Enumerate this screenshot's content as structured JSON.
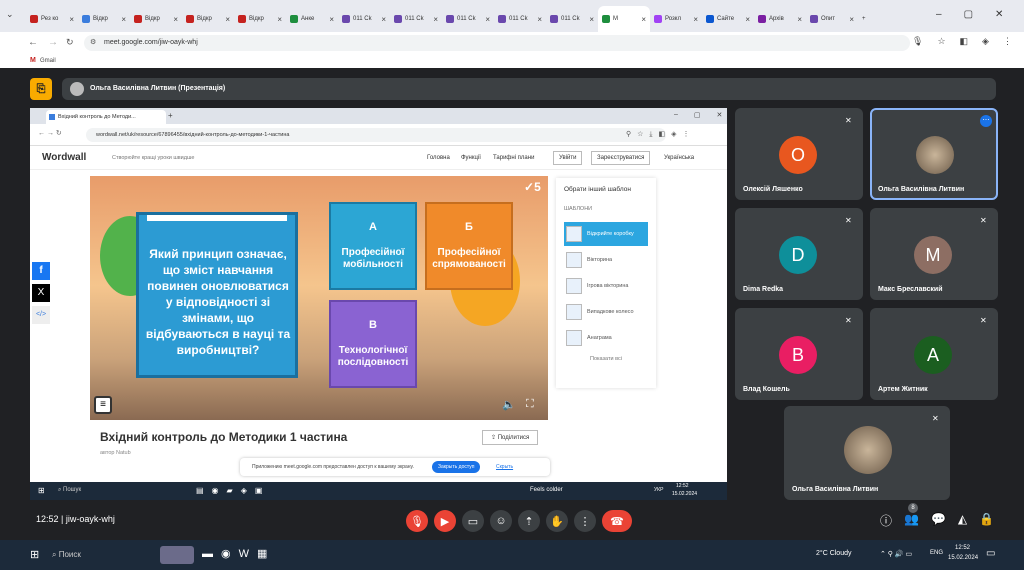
{
  "browser": {
    "tabs": [
      {
        "label": "Рез ко"
      },
      {
        "label": "Відкр"
      },
      {
        "label": "Відкр"
      },
      {
        "label": "Відкр"
      },
      {
        "label": "Відкр"
      },
      {
        "label": "Анке"
      },
      {
        "label": "011 Ck"
      },
      {
        "label": "011 Ck"
      },
      {
        "label": "011 Ck"
      },
      {
        "label": "011 Ck"
      },
      {
        "label": "011 Ck"
      },
      {
        "label": "М"
      },
      {
        "label": "Розкл"
      },
      {
        "label": "Сайте"
      },
      {
        "label": "Архів"
      },
      {
        "label": "Опит"
      }
    ],
    "url": "meet.google.com/jiw-oayk-whj",
    "bookmark": "Gmail"
  },
  "meet": {
    "presenter_label": "Ольга Василівна Литвин (Презентація)",
    "meeting_time": "12:52",
    "meeting_code": "jiw-oayk-whj",
    "people_count": "8",
    "participants": [
      {
        "name": "Олексій Ляшенко",
        "initial": "О",
        "color": "#e8571f"
      },
      {
        "name": "Ольга Василівна Литвин",
        "initial": "",
        "color": "#888"
      },
      {
        "name": "Dima Redka",
        "initial": "D",
        "color": "#0e8f9a"
      },
      {
        "name": "Макс Бреславский",
        "initial": "М",
        "color": "#8d6e63"
      },
      {
        "name": "Влад Кошель",
        "initial": "В",
        "color": "#e91e63"
      },
      {
        "name": "Артем Житник",
        "initial": "А",
        "color": "#1b5e20"
      }
    ],
    "self_name": "Ольга Василівна Литвин"
  },
  "shared": {
    "tab_title": "Вхідний контроль до Методи...",
    "url": "wordwall.net/uk/resource/67896455/вхідний-контроль-до-методики-1-частина",
    "logo": "Wordwall",
    "tagline": "Створюйте кращі уроки швидше",
    "nav": [
      "Головна",
      "Функції",
      "Тарифні плани"
    ],
    "login": "Увійти",
    "signup": "Зареєструватися",
    "lang": "Українська",
    "question": "Який принцип означає, що зміст навчання повинен оновлюватися у відповідності зі змінами, що відбуваються в науці та виробництві?",
    "score": "5",
    "answers": [
      {
        "letter": "А",
        "text": "Професійної мобільності",
        "color": "#2ca6d4"
      },
      {
        "letter": "Б",
        "text": "Професійної спрямованості",
        "color": "#f08a2a"
      },
      {
        "letter": "В",
        "text": "Технологічної послідовності",
        "color": "#8a63d2"
      }
    ],
    "sidebar_title": "Обрати інший шаблон",
    "sidebar_sub": "ШАБЛОНИ",
    "templates": [
      "Відкрийте коробку",
      "Вікторина",
      "Ігрова вікторина",
      "Випадкове колесо",
      "Анаграма"
    ],
    "show_all": "Показати всі",
    "activity_title": "Вхідний контроль до Методики 1 частина",
    "author_label": "автор",
    "author": "Natub",
    "share": "Поділитися",
    "notice": "Приложению meet.google.com предоставлен доступ к вашему экрану.",
    "stop_btn": "Закрыть доступ",
    "hide_btn": "Скрыть",
    "inner_search": "Пошук",
    "inner_weather": "Feels colder",
    "inner_lang": "УКР",
    "inner_time": "12:52",
    "inner_date": "15.02.2024"
  },
  "taskbar": {
    "search": "Поиск",
    "weather": "2°C  Cloudy",
    "lang": "ENG",
    "time": "12:52",
    "date": "15.02.2024"
  }
}
